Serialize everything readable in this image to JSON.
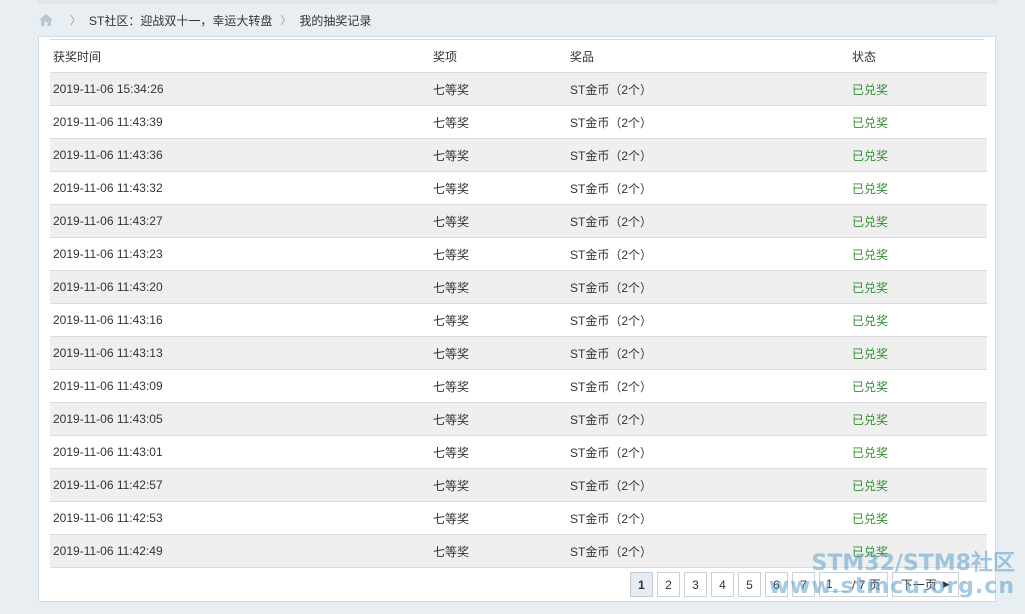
{
  "breadcrumb": {
    "items": [
      "ST社区：迎战双十一，幸运大转盘",
      "我的抽奖记录"
    ]
  },
  "table": {
    "headers": [
      "获奖时间",
      "奖项",
      "奖品",
      "状态"
    ],
    "rows": [
      {
        "time": "2019-11-06 15:34:26",
        "level": "七等奖",
        "prize": "ST金币（2个）",
        "status": "已兑奖"
      },
      {
        "time": "2019-11-06 11:43:39",
        "level": "七等奖",
        "prize": "ST金币（2个）",
        "status": "已兑奖"
      },
      {
        "time": "2019-11-06 11:43:36",
        "level": "七等奖",
        "prize": "ST金币（2个）",
        "status": "已兑奖"
      },
      {
        "time": "2019-11-06 11:43:32",
        "level": "七等奖",
        "prize": "ST金币（2个）",
        "status": "已兑奖"
      },
      {
        "time": "2019-11-06 11:43:27",
        "level": "七等奖",
        "prize": "ST金币（2个）",
        "status": "已兑奖"
      },
      {
        "time": "2019-11-06 11:43:23",
        "level": "七等奖",
        "prize": "ST金币（2个）",
        "status": "已兑奖"
      },
      {
        "time": "2019-11-06 11:43:20",
        "level": "七等奖",
        "prize": "ST金币（2个）",
        "status": "已兑奖"
      },
      {
        "time": "2019-11-06 11:43:16",
        "level": "七等奖",
        "prize": "ST金币（2个）",
        "status": "已兑奖"
      },
      {
        "time": "2019-11-06 11:43:13",
        "level": "七等奖",
        "prize": "ST金币（2个）",
        "status": "已兑奖"
      },
      {
        "time": "2019-11-06 11:43:09",
        "level": "七等奖",
        "prize": "ST金币（2个）",
        "status": "已兑奖"
      },
      {
        "time": "2019-11-06 11:43:05",
        "level": "七等奖",
        "prize": "ST金币（2个）",
        "status": "已兑奖"
      },
      {
        "time": "2019-11-06 11:43:01",
        "level": "七等奖",
        "prize": "ST金币（2个）",
        "status": "已兑奖"
      },
      {
        "time": "2019-11-06 11:42:57",
        "level": "七等奖",
        "prize": "ST金币（2个）",
        "status": "已兑奖"
      },
      {
        "time": "2019-11-06 11:42:53",
        "level": "七等奖",
        "prize": "ST金币（2个）",
        "status": "已兑奖"
      },
      {
        "time": "2019-11-06 11:42:49",
        "level": "七等奖",
        "prize": "ST金币（2个）",
        "status": "已兑奖"
      }
    ]
  },
  "pagination": {
    "pages": [
      "1",
      "2",
      "3",
      "4",
      "5",
      "6",
      "7"
    ],
    "current": "1",
    "jump_value": "1",
    "total_label": "/ 7 页",
    "next_label": "下一页"
  },
  "watermark": {
    "line1": "STM32/STM8社区",
    "line2": "www.stmcu.org.cn"
  },
  "colors": {
    "status_green": "#2f8f2f",
    "row_alt": "#efefef"
  },
  "icons": {
    "home": "home-icon",
    "separator": "chevron-right-icon",
    "next": "triangle-right-icon"
  }
}
